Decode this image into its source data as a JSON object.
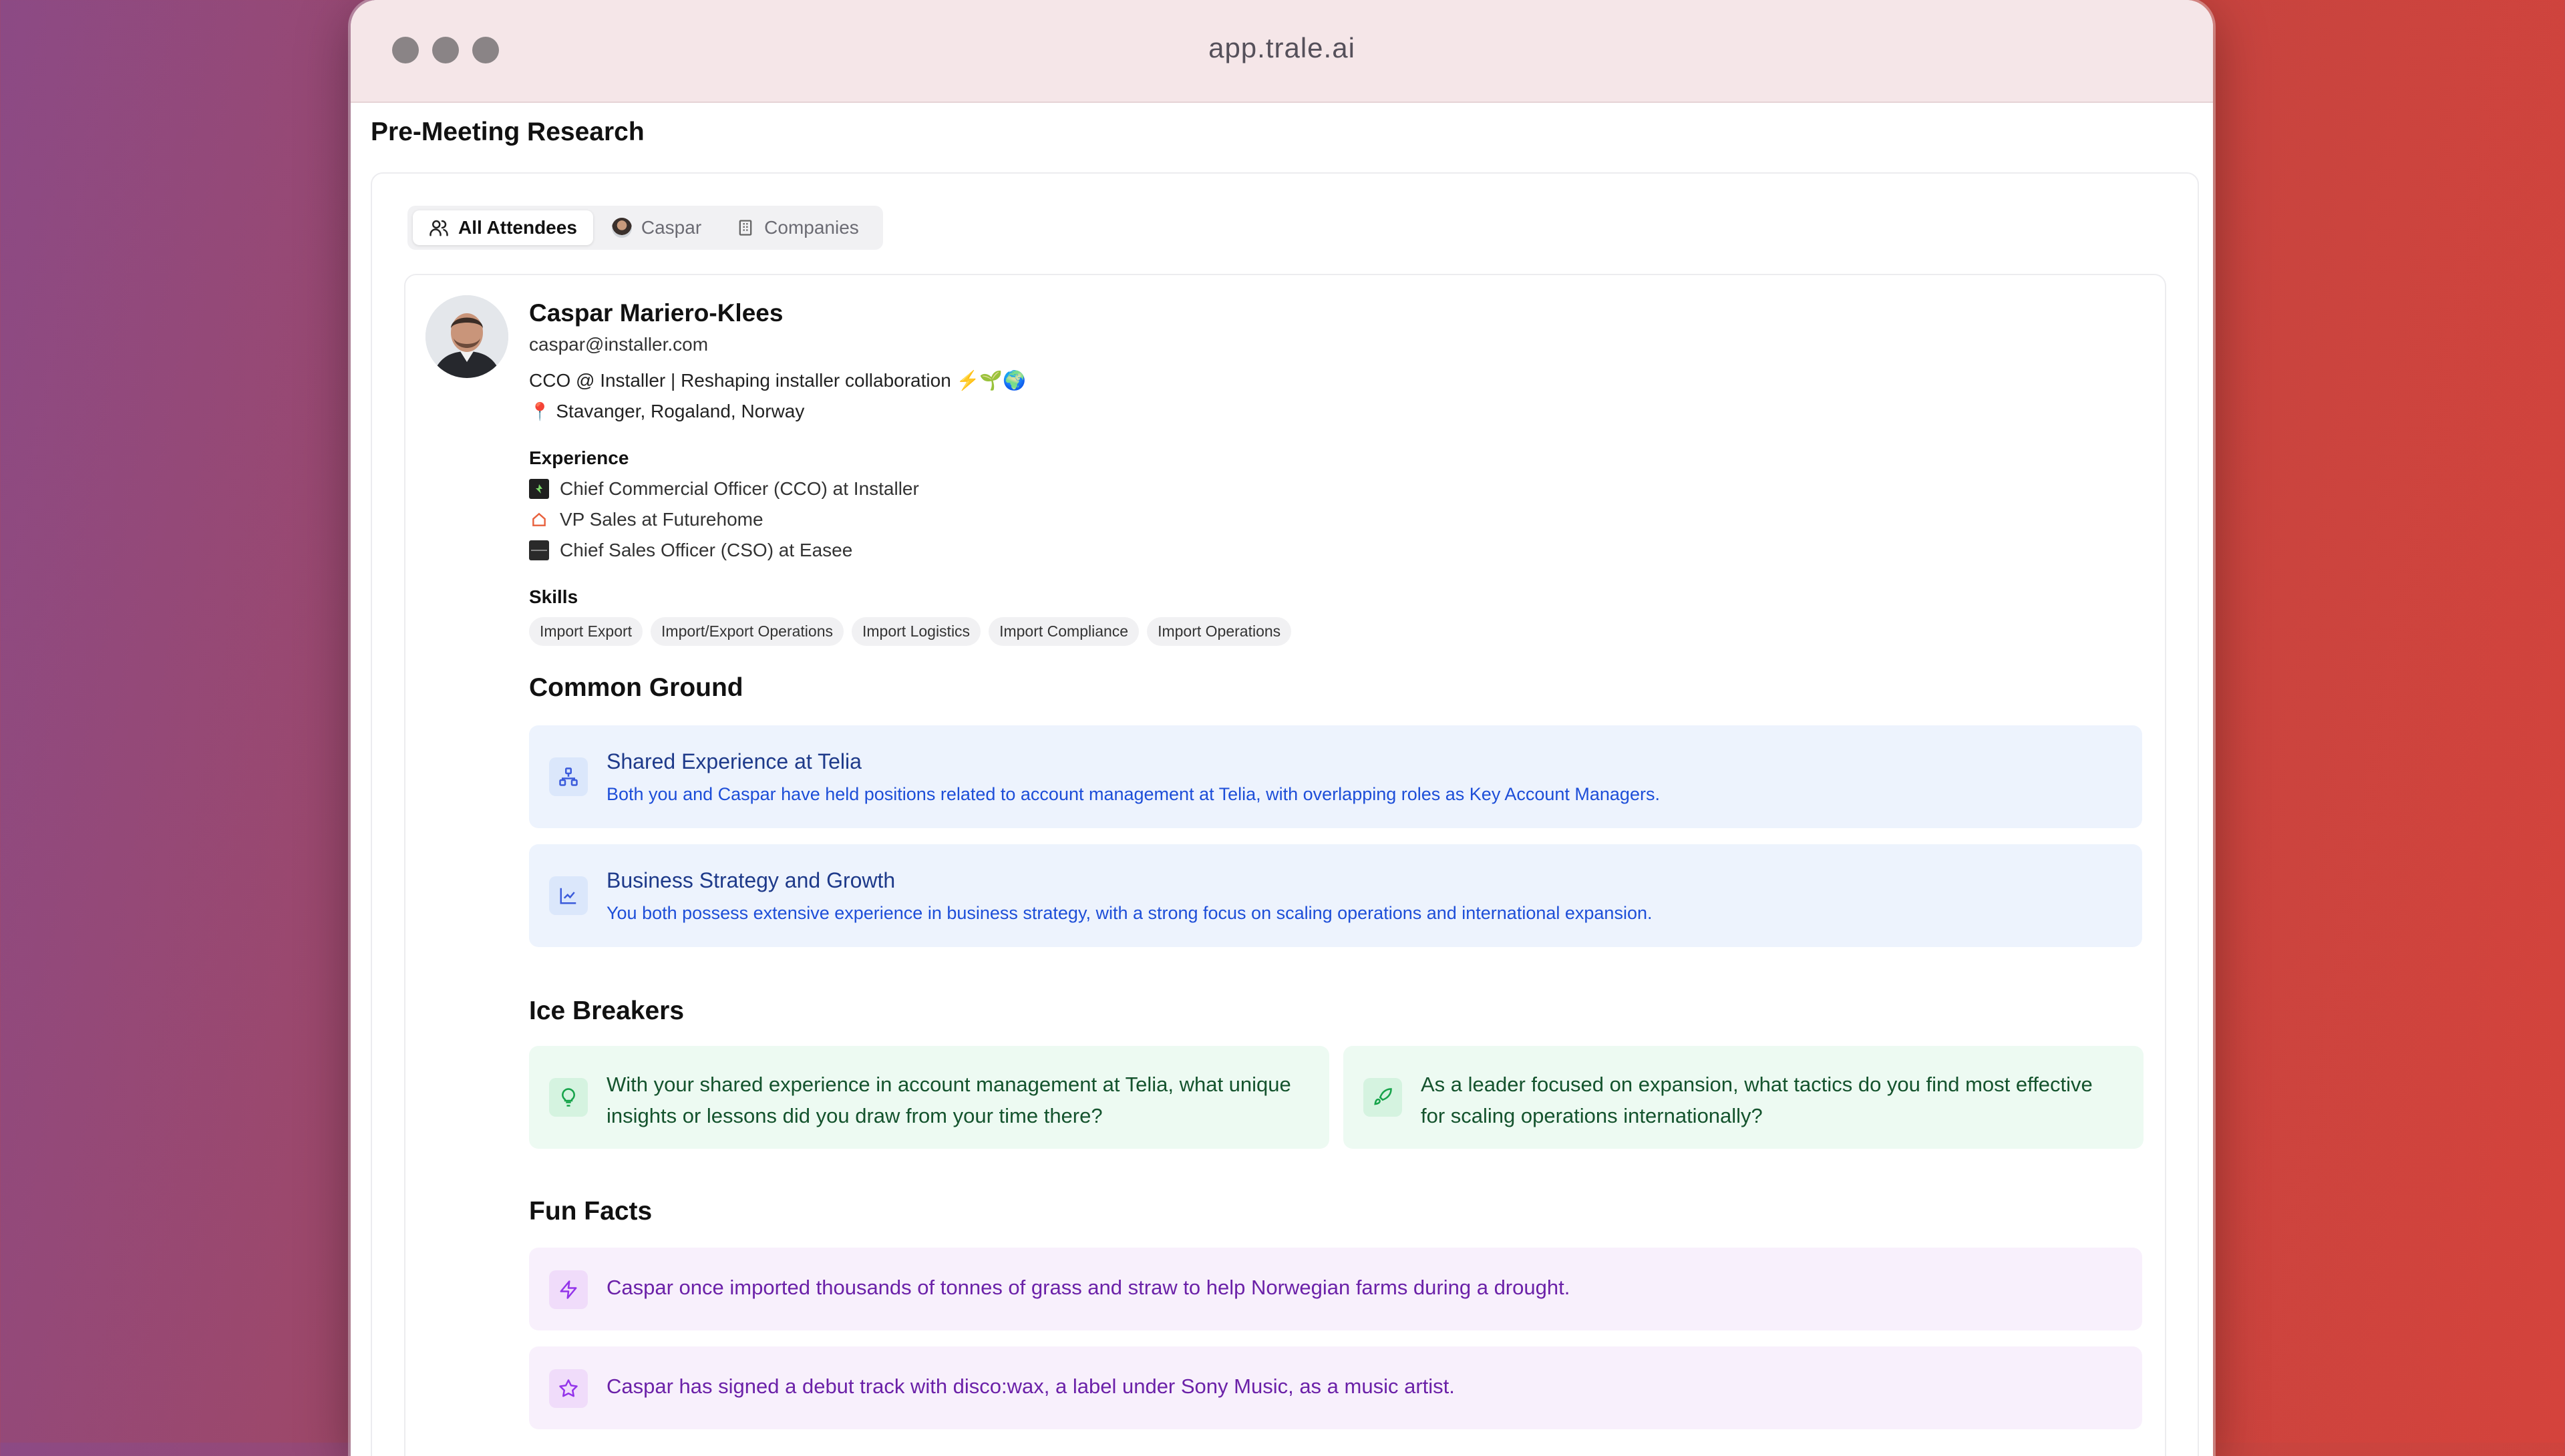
{
  "browser": {
    "url": "app.trale.ai"
  },
  "page": {
    "title": "Pre-Meeting Research"
  },
  "tabs": [
    {
      "label": "All Attendees",
      "icon": "users-icon",
      "active": true
    },
    {
      "label": "Caspar",
      "icon": "avatar-icon",
      "active": false
    },
    {
      "label": "Companies",
      "icon": "building-icon",
      "active": false
    }
  ],
  "profile": {
    "name": "Caspar Mariero-Klees",
    "email": "caspar@installer.com",
    "headline": "CCO @ Installer | Reshaping installer collaboration ⚡🌱🌍",
    "location": "Stavanger, Rogaland, Norway",
    "experience_label": "Experience",
    "experience": [
      {
        "text": "Chief Commercial Officer (CCO) at Installer",
        "logo_color": "#1f1f1f"
      },
      {
        "text": "VP Sales at Futurehome",
        "logo_color": "#e8603c"
      },
      {
        "text": "Chief Sales Officer (CSO) at Easee",
        "logo_color": "#2a2a2a"
      }
    ],
    "skills_label": "Skills",
    "skills": [
      "Import Export",
      "Import/Export Operations",
      "Import Logistics",
      "Import Compliance",
      "Import Operations"
    ]
  },
  "common_ground": {
    "heading": "Common Ground",
    "items": [
      {
        "title": "Shared Experience at Telia",
        "text": "Both you and Caspar have held positions related to account management at Telia, with overlapping roles as Key Account Managers.",
        "icon": "network-icon"
      },
      {
        "title": "Business Strategy and Growth",
        "text": "You both possess extensive experience in business strategy, with a strong focus on scaling operations and international expansion.",
        "icon": "chart-line-icon"
      }
    ]
  },
  "ice_breakers": {
    "heading": "Ice Breakers",
    "items": [
      {
        "text": "With your shared experience in account management at Telia, what unique insights or lessons did you draw from your time there?",
        "icon": "lightbulb-icon"
      },
      {
        "text": "As a leader focused on expansion, what tactics do you find most effective for scaling operations internationally?",
        "icon": "rocket-icon"
      }
    ]
  },
  "fun_facts": {
    "heading": "Fun Facts",
    "items": [
      {
        "text": "Caspar once imported thousands of tonnes of grass and straw to help Norwegian farms during a drought.",
        "icon": "zap-icon"
      },
      {
        "text": "Caspar has signed a debut track with disco:wax, a label under Sony Music, as a music artist.",
        "icon": "star-icon"
      }
    ]
  },
  "colors": {
    "common_ground_bg": "#edf3fd",
    "ice_breaker_bg": "#edfaf2",
    "fun_fact_bg": "#f8f0fc"
  }
}
